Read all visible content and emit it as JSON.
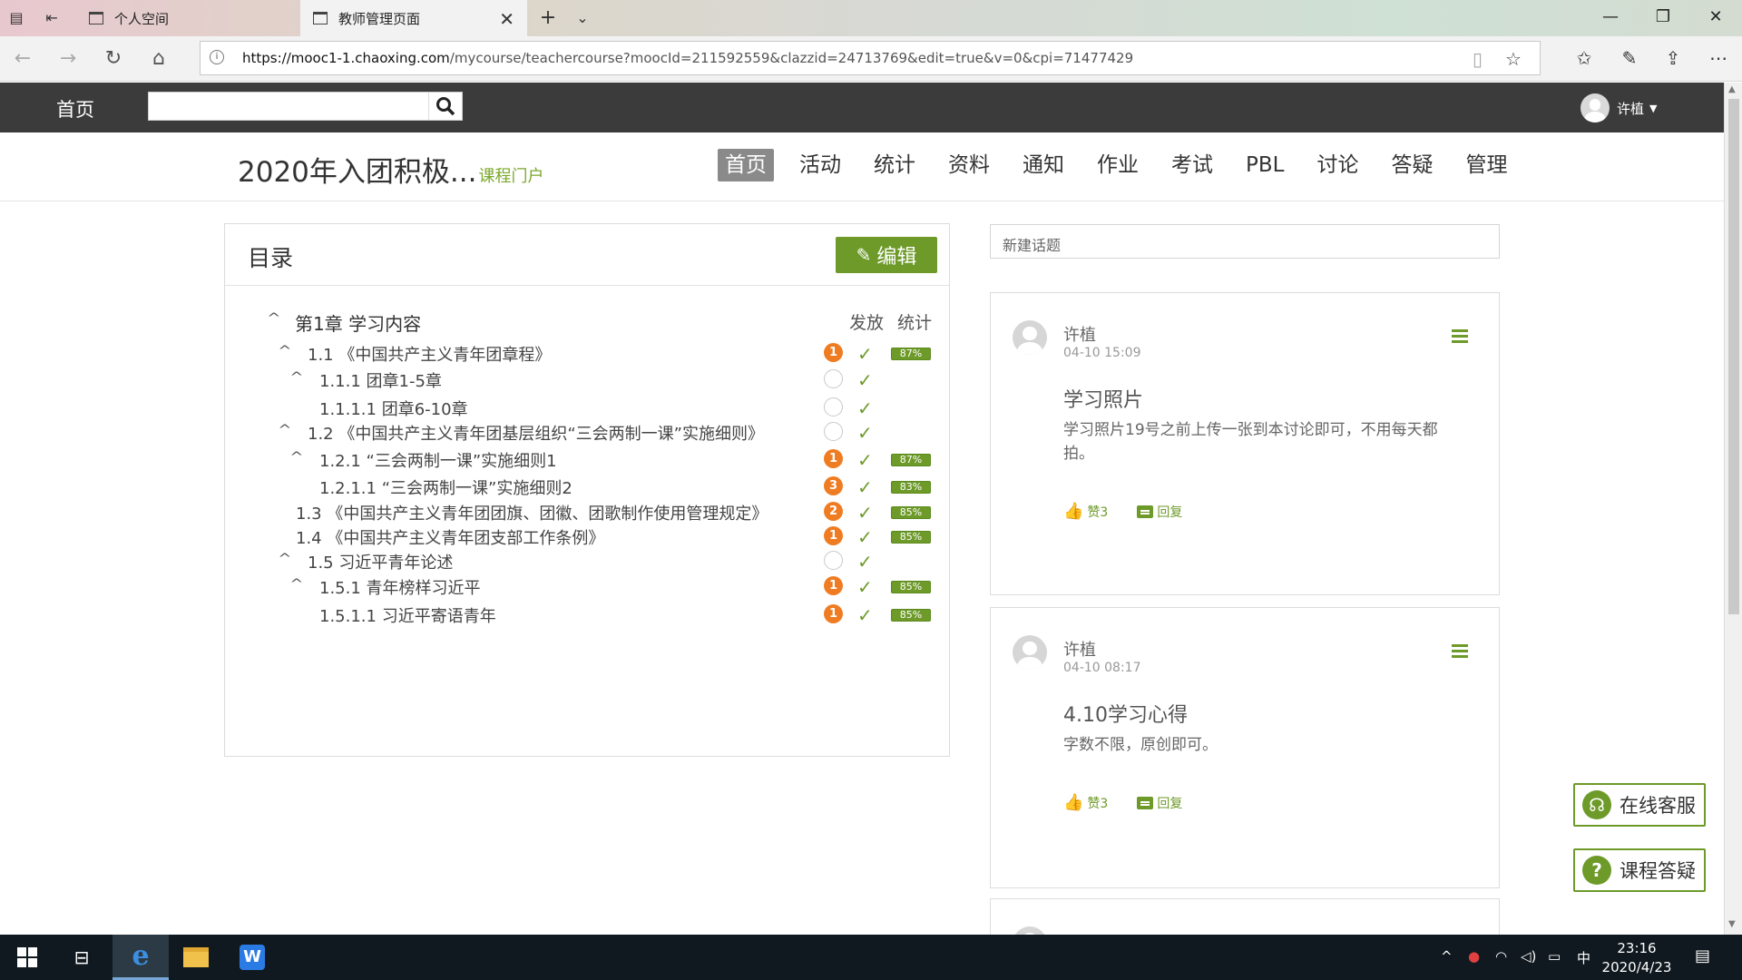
{
  "browser": {
    "tabs": [
      {
        "label": "个人空间"
      },
      {
        "label": "教师管理页面"
      }
    ],
    "url_host": "https://mooc1-1.chaoxing.com",
    "url_path": "/mycourse/teachercourse?moocId=211592559&clazzid=24713769&edit=true&v=0&cpi=71477429"
  },
  "site": {
    "home": "首页",
    "search_placeholder": "",
    "username": "许植"
  },
  "course": {
    "title": "2020年入团积极...",
    "portal": "课程门户",
    "nav": [
      "首页",
      "活动",
      "统计",
      "资料",
      "通知",
      "作业",
      "考试",
      "PBL",
      "讨论",
      "答疑",
      "管理"
    ],
    "active_nav": "首页"
  },
  "catalog": {
    "title": "目录",
    "edit_label": "编辑",
    "col_release": "发放",
    "col_stats": "统计",
    "chapter": "第1章 学习内容",
    "items": [
      {
        "label": "1.1 《中国共产主义青年团章程》",
        "badge": "1",
        "pct": "87%"
      },
      {
        "label": "1.1.1 团章1-5章",
        "badge": "",
        "pct": ""
      },
      {
        "label": "1.1.1.1 团章6-10章",
        "badge": "",
        "pct": ""
      },
      {
        "label": "1.2 《中国共产主义青年团基层组织“三会两制一课”实施细则》",
        "badge": "",
        "pct": ""
      },
      {
        "label": "1.2.1 “三会两制一课”实施细则1",
        "badge": "1",
        "pct": "87%"
      },
      {
        "label": "1.2.1.1 “三会两制一课”实施细则2",
        "badge": "3",
        "pct": "83%"
      },
      {
        "label": "1.3 《中国共产主义青年团团旗、团徽、团歌制作使用管理规定》",
        "badge": "2",
        "pct": "85%"
      },
      {
        "label": "1.4 《中国共产主义青年团支部工作条例》",
        "badge": "1",
        "pct": "85%"
      },
      {
        "label": "1.5 习近平青年论述",
        "badge": "",
        "pct": ""
      },
      {
        "label": "1.5.1 青年榜样习近平",
        "badge": "1",
        "pct": "85%"
      },
      {
        "label": "1.5.1.1 习近平寄语青年",
        "badge": "1",
        "pct": "85%"
      }
    ]
  },
  "discussion": {
    "new_topic_placeholder": "新建话题",
    "posts": [
      {
        "user": "许植",
        "time": "04-10 15:09",
        "title": "学习照片",
        "body": "学习照片19号之前上传一张到本讨论即可，不用每天都拍。",
        "likes": "赞3",
        "reply": "回复"
      },
      {
        "user": "许植",
        "time": "04-10 08:17",
        "title": "4.10学习心得",
        "body": "字数不限，原创即可。",
        "likes": "赞3",
        "reply": "回复"
      }
    ]
  },
  "floating": {
    "service": "在线客服",
    "qa": "课程答疑"
  },
  "taskbar": {
    "ime": "中",
    "time": "23:16",
    "date": "2020/4/23"
  },
  "colors": {
    "accent": "#6d9a29",
    "badge": "#ef7c22",
    "header": "#3b3b3b"
  }
}
